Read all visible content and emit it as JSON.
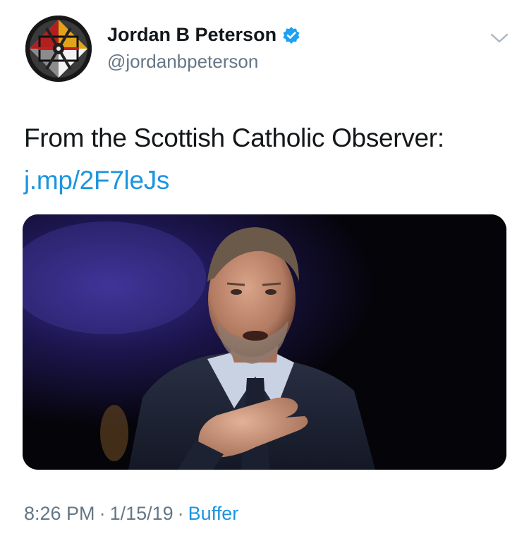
{
  "author": {
    "display_name": "Jordan B Peterson",
    "handle": "@jordanbpeterson",
    "verified": true
  },
  "tweet": {
    "text": "From the Scottish Catholic Observer:",
    "link": "j.mp/2F7leJs"
  },
  "meta": {
    "time": "8:26 PM",
    "separator": "·",
    "date": "1/15/19",
    "source": "Buffer"
  },
  "colors": {
    "link": "#1b95e0",
    "secondary": "#657786",
    "verified_badge": "#1da1f2"
  },
  "icons": {
    "verified": "verified-badge-icon",
    "caret": "chevron-down-icon"
  }
}
